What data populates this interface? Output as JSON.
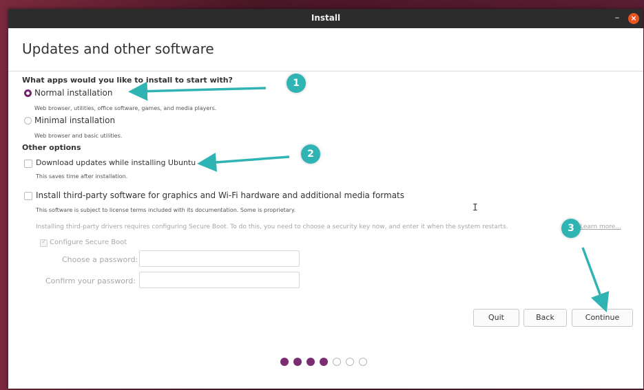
{
  "window": {
    "title": "Install",
    "minimize_glyph": "–",
    "close_glyph": "×"
  },
  "page_title": "Updates and other software",
  "question": "What apps would you like to install to start with?",
  "install_options": [
    {
      "label": "Normal installation",
      "desc": "Web browser, utilities, office software, games, and media players.",
      "selected": true
    },
    {
      "label": "Minimal installation",
      "desc": "Web browser and basic utilities.",
      "selected": false
    }
  ],
  "other_options_title": "Other options",
  "download_updates": {
    "label": "Download updates while installing Ubuntu",
    "desc": "This saves time after installation.",
    "checked": false
  },
  "third_party": {
    "label": "Install third-party software for graphics and Wi-Fi hardware and additional media formats",
    "desc": "This software is subject to license terms included with its documentation. Some is proprietary.",
    "checked": false
  },
  "secure_boot": {
    "note": "Installing third-party drivers requires configuring Secure Boot. To do this, you need to choose a security key now, and enter it when the system restarts.",
    "learn_more": "Learn more...",
    "configure_label": "Configure Secure Boot",
    "password_label": "Choose a password:",
    "confirm_label": "Confirm your password:",
    "password_value": "",
    "confirm_value": ""
  },
  "buttons": {
    "quit": "Quit",
    "back": "Back",
    "continue": "Continue"
  },
  "progress": {
    "total": 7,
    "completed": 4
  },
  "annotations": [
    {
      "number": "1",
      "color": "#2fb3b3"
    },
    {
      "number": "2",
      "color": "#2fb3b3"
    },
    {
      "number": "3",
      "color": "#2fb3b3"
    }
  ],
  "colors": {
    "accent": "#77216f",
    "titlebar": "#2c2c2c",
    "close": "#e95420",
    "annotation": "#2fb3b3"
  }
}
